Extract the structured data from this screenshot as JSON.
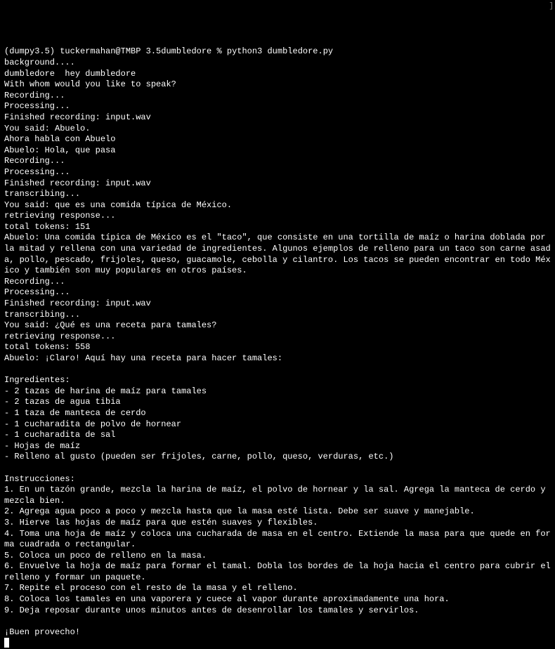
{
  "scroll_indicator": "]",
  "prompt": {
    "env": "(dumpy3.5)",
    "user_host": "tuckermahan@TMBP",
    "path": "3.5dumbledore",
    "symbol": "%",
    "command": "python3 dumbledore.py"
  },
  "lines": [
    "background....",
    "dumbledore  hey dumbledore",
    "With whom would you like to speak?",
    "Recording...",
    "Processing...",
    "Finished recording: input.wav",
    "You said: Abuelo.",
    "Ahora habla con Abuelo",
    "Abuelo: Hola, que pasa",
    "Recording...",
    "Processing...",
    "Finished recording: input.wav",
    "transcribing...",
    "You said: que es una comida típica de México.",
    "retrieving response...",
    "total tokens: 151",
    "Abuelo: Una comida típica de México es el \"taco\", que consiste en una tortilla de maíz o harina doblada por la mitad y rellena con una variedad de ingredientes. Algunos ejemplos de relleno para un taco son carne asada, pollo, pescado, frijoles, queso, guacamole, cebolla y cilantro. Los tacos se pueden encontrar en todo México y también son muy populares en otros países.",
    "Recording...",
    "Processing...",
    "Finished recording: input.wav",
    "transcribing...",
    "You said: ¿Qué es una receta para tamales?",
    "retrieving response...",
    "total tokens: 558",
    "Abuelo: ¡Claro! Aquí hay una receta para hacer tamales:",
    "",
    "Ingredientes:",
    "- 2 tazas de harina de maíz para tamales",
    "- 2 tazas de agua tibia",
    "- 1 taza de manteca de cerdo",
    "- 1 cucharadita de polvo de hornear",
    "- 1 cucharadita de sal",
    "- Hojas de maíz",
    "- Relleno al gusto (pueden ser frijoles, carne, pollo, queso, verduras, etc.)",
    "",
    "Instrucciones:",
    "1. En un tazón grande, mezcla la harina de maíz, el polvo de hornear y la sal. Agrega la manteca de cerdo y mezcla bien.",
    "2. Agrega agua poco a poco y mezcla hasta que la masa esté lista. Debe ser suave y manejable.",
    "3. Hierve las hojas de maíz para que estén suaves y flexibles.",
    "4. Toma una hoja de maíz y coloca una cucharada de masa en el centro. Extiende la masa para que quede en forma cuadrada o rectangular.",
    "5. Coloca un poco de relleno en la masa.",
    "6. Envuelve la hoja de maíz para formar el tamal. Dobla los bordes de la hoja hacia el centro para cubrir el relleno y formar un paquete.",
    "7. Repite el proceso con el resto de la masa y el relleno.",
    "8. Coloca los tamales en una vaporera y cuece al vapor durante aproximadamente una hora.",
    "9. Deja reposar durante unos minutos antes de desenrollar los tamales y servirlos.",
    "",
    "¡Buen provecho!"
  ]
}
